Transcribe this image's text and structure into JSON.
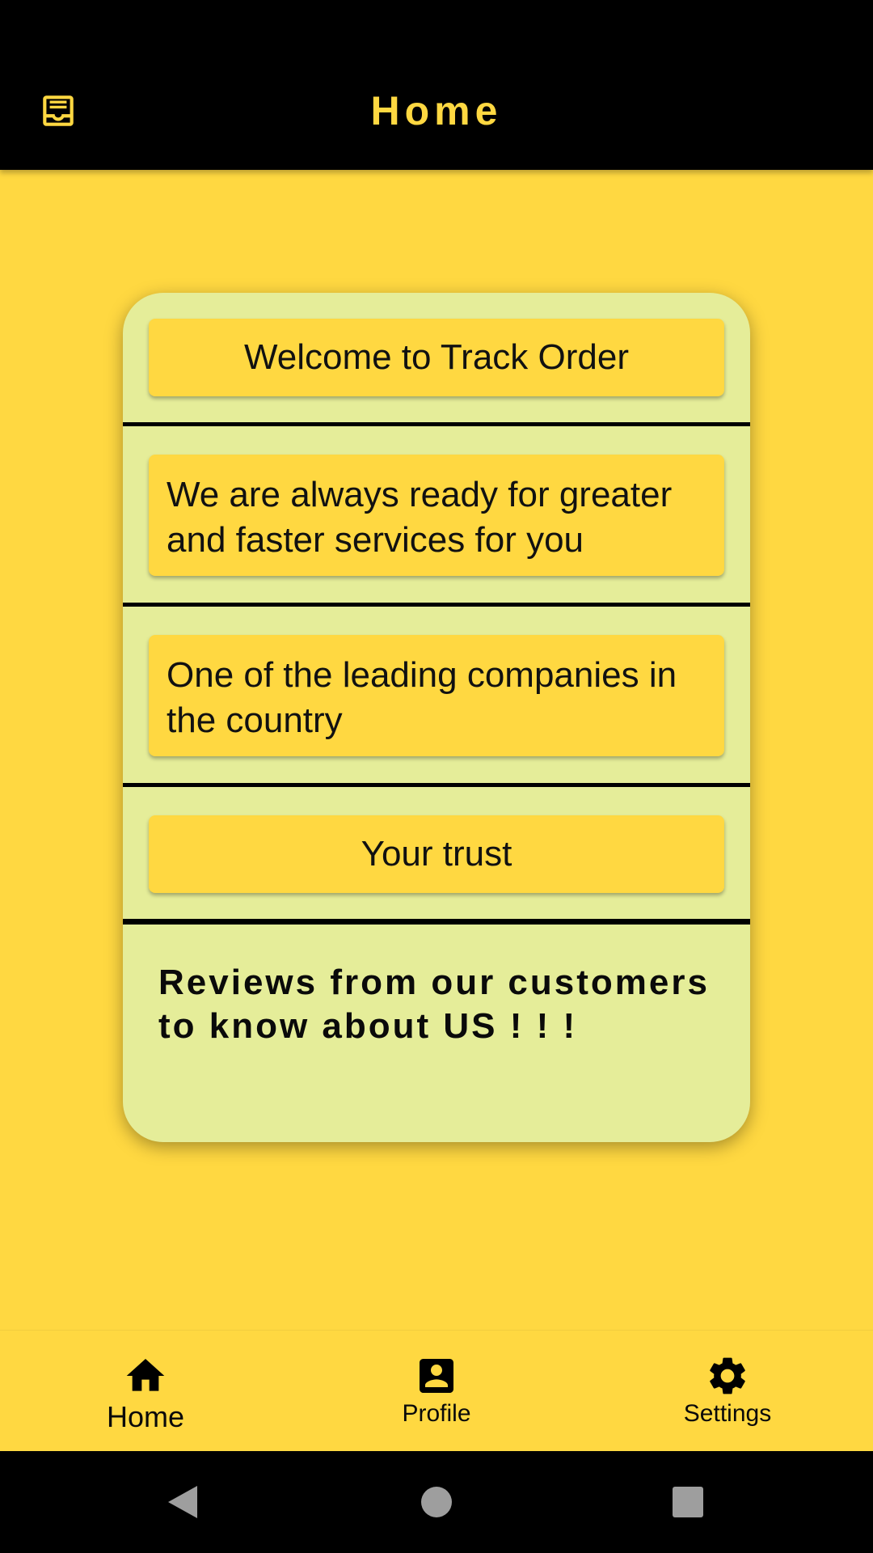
{
  "app_bar": {
    "title": "Home",
    "menu_icon": "inbox-tray-icon",
    "background": "#000000",
    "accent": "#FFD841"
  },
  "card": {
    "background": "#E5ED99",
    "items": [
      "Welcome to Track Order",
      "We are always ready for greater and faster services for you",
      "One of the leading companies in the country",
      "Your trust"
    ],
    "reviews_text": "Reviews from our customers to know about US ! ! !"
  },
  "bottom_nav": {
    "items": [
      {
        "label": "Home",
        "icon": "home-icon",
        "active": true
      },
      {
        "label": "Profile",
        "icon": "profile-icon",
        "active": false
      },
      {
        "label": "Settings",
        "icon": "settings-icon",
        "active": false
      }
    ]
  },
  "system_nav": {
    "back": "back-icon",
    "home": "home-circle-icon",
    "recents": "recents-icon"
  },
  "colors": {
    "page_background": "#FFD841",
    "card_background": "#E5ED99",
    "pill_background": "#FFD841"
  }
}
